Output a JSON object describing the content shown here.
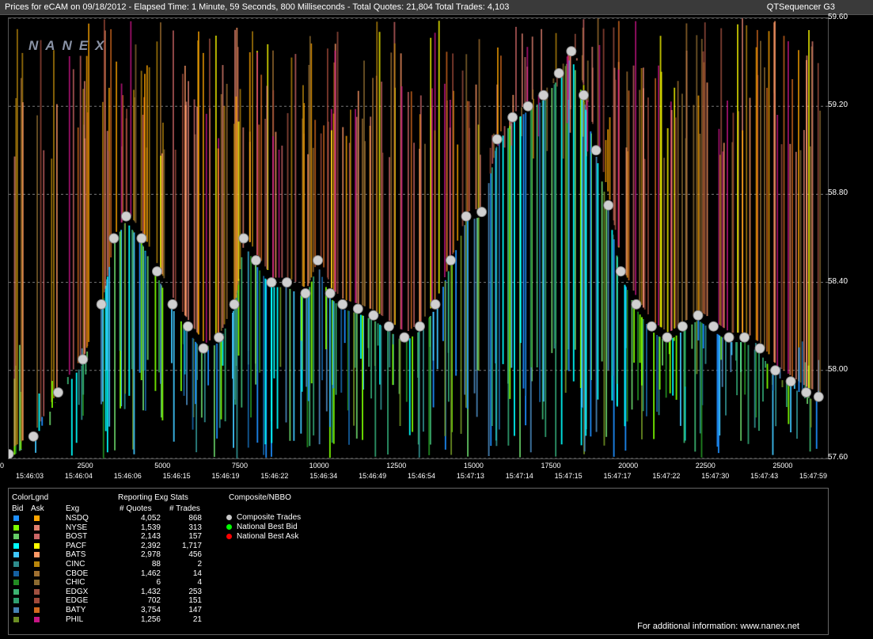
{
  "window": {
    "title": "Prices for  eCAM  on  09/18/2012  -  Elapsed Time: 1 Minute, 59 Seconds, 800 Milliseconds  -  Total Quotes: 21,804  Total Trades: 4,103",
    "app_name": "QTSequencer G3"
  },
  "logo_text": "NANEX",
  "y_ticks": [
    "59.60",
    "59.20",
    "58.80",
    "58.40",
    "58.00",
    "57.60"
  ],
  "x_ticks": [
    "0",
    "2500",
    "5000",
    "7500",
    "10000",
    "12500",
    "15000",
    "17500",
    "20000",
    "22500",
    "25000"
  ],
  "time_ticks": [
    "15:46:03",
    "15:46:04",
    "15:46:06",
    "15:46:15",
    "15:46:19",
    "15:46:22",
    "15:46:34",
    "15:46:49",
    "15:46:54",
    "15:47:13",
    "15:47:14",
    "15:47:15",
    "15:47:17",
    "15:47:22",
    "15:47:30",
    "15:47:43",
    "15:47:59"
  ],
  "chart_data": {
    "type": "scatter",
    "ylim": [
      57.6,
      59.6
    ],
    "xlim": [
      0,
      26500
    ],
    "series": [
      {
        "name": "Composite Trades",
        "x": [
          0,
          800,
          1600,
          2400,
          3000,
          3400,
          3800,
          4300,
          4800,
          5300,
          5800,
          6300,
          6800,
          7300,
          7600,
          8000,
          8500,
          9000,
          9600,
          10000,
          10400,
          10800,
          11300,
          11800,
          12300,
          12800,
          13300,
          13800,
          14300,
          14800,
          15300,
          15800,
          16300,
          16800,
          17300,
          17800,
          18200,
          18600,
          19000,
          19400,
          19800,
          20300,
          20800,
          21300,
          21800,
          22300,
          22800,
          23300,
          23800,
          24300,
          24800,
          25300,
          25800,
          26200
        ],
        "y": [
          57.62,
          57.7,
          57.9,
          58.05,
          58.3,
          58.6,
          58.7,
          58.6,
          58.45,
          58.3,
          58.2,
          58.1,
          58.15,
          58.3,
          58.6,
          58.5,
          58.4,
          58.4,
          58.35,
          58.5,
          58.35,
          58.3,
          58.28,
          58.25,
          58.2,
          58.15,
          58.2,
          58.3,
          58.5,
          58.7,
          58.72,
          59.05,
          59.15,
          59.2,
          59.25,
          59.35,
          59.45,
          59.25,
          59.0,
          58.75,
          58.45,
          58.3,
          58.2,
          58.15,
          58.2,
          58.25,
          58.2,
          58.15,
          58.15,
          58.1,
          58.0,
          57.95,
          57.9,
          57.88
        ]
      }
    ]
  },
  "stats": {
    "color_legend": "ColorLgnd",
    "bid_label": "Bid",
    "ask_label": "Ask",
    "exg_label": "Exg",
    "reporting_label": "Reporting Exg Stats",
    "quotes_label": "# Quotes",
    "trades_label": "# Trades",
    "composite_label": "Composite/NBBO",
    "rows": [
      {
        "exg": "NSDQ",
        "quotes": "4,052",
        "trades": "868",
        "bid": "#1e90ff",
        "ask": "#ffa500"
      },
      {
        "exg": "NYSE",
        "quotes": "1,539",
        "trades": "313",
        "bid": "#7cfc00",
        "ask": "#e08070"
      },
      {
        "exg": "BOST",
        "quotes": "2,143",
        "trades": "157",
        "bid": "#66cc66",
        "ask": "#cc6666"
      },
      {
        "exg": "PACF",
        "quotes": "2,392",
        "trades": "1,717",
        "bid": "#00ffff",
        "ask": "#ffff00"
      },
      {
        "exg": "BATS",
        "quotes": "2,978",
        "trades": "456",
        "bid": "#40c8ff",
        "ask": "#ff9966"
      },
      {
        "exg": "CINC",
        "quotes": "88",
        "trades": "2",
        "bid": "#2e8b8b",
        "ask": "#b8860b"
      },
      {
        "exg": "CBOE",
        "quotes": "1,462",
        "trades": "14",
        "bid": "#1560a0",
        "ask": "#a07030"
      },
      {
        "exg": "CHIC",
        "quotes": "6",
        "trades": "4",
        "bid": "#228b22",
        "ask": "#8b6a30"
      },
      {
        "exg": "EDGX",
        "quotes": "1,432",
        "trades": "253",
        "bid": "#3cb371",
        "ask": "#a05040"
      },
      {
        "exg": "EDGE",
        "quotes": "702",
        "trades": "151",
        "bid": "#2f9f6f",
        "ask": "#a04a3a"
      },
      {
        "exg": "BATY",
        "quotes": "3,754",
        "trades": "147",
        "bid": "#4682b4",
        "ask": "#d2691e"
      },
      {
        "exg": "PHIL",
        "quotes": "1,256",
        "trades": "21",
        "bid": "#6b8e23",
        "ask": "#c71585"
      }
    ]
  },
  "legend": [
    {
      "label": "Composite Trades",
      "color": "#c8c8c8"
    },
    {
      "label": "National Best Bid",
      "color": "#00ff00"
    },
    {
      "label": "National Best Ask",
      "color": "#ff0000"
    }
  ],
  "footer": "For additional information: www.nanex.net"
}
